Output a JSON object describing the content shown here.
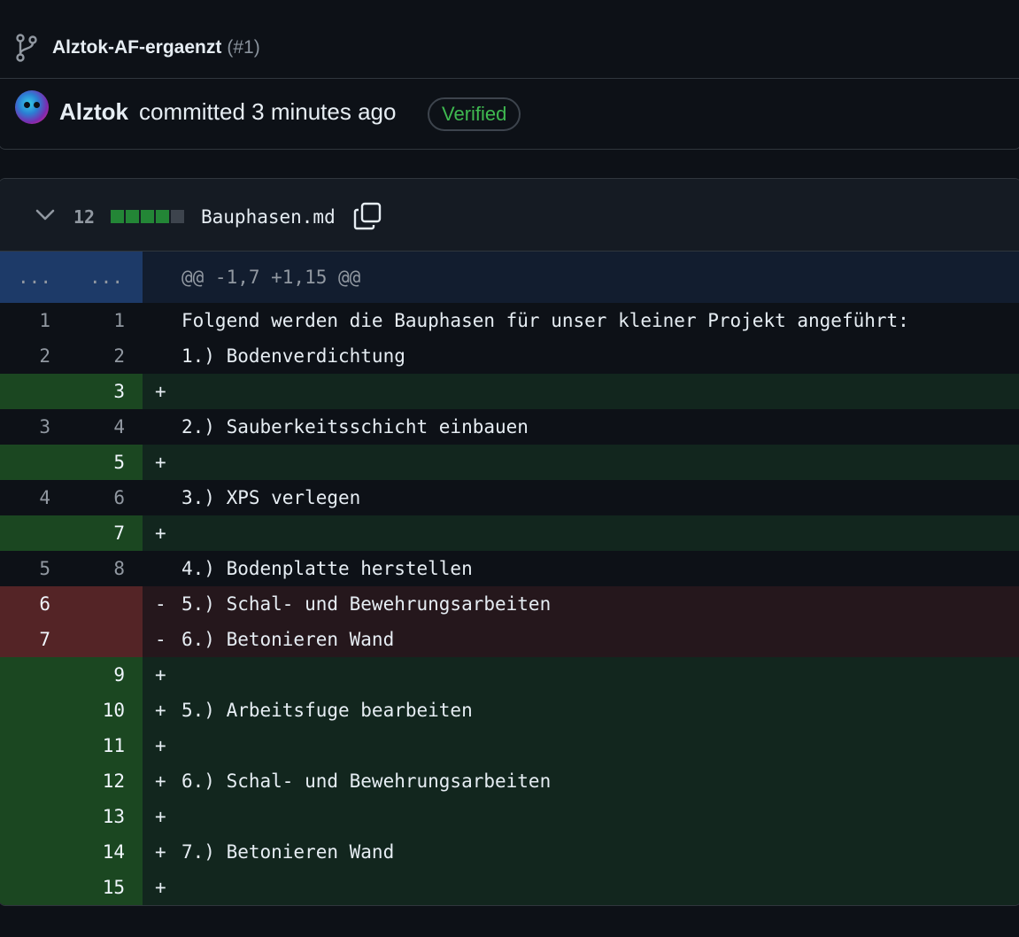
{
  "commit": {
    "branch_name": "Alztok-AF-ergaenzt",
    "pr_number": "(#1)",
    "author": "Alztok",
    "meta": "committed 3 minutes ago",
    "verified_label": "Verified"
  },
  "file": {
    "changes_count": "12",
    "diffstat": [
      "add",
      "add",
      "add",
      "add",
      "neutral"
    ],
    "name": "Bauphasen.md"
  },
  "diff": {
    "hunk": {
      "old": "...",
      "new": "...",
      "header": "@@ -1,7 +1,15 @@"
    },
    "lines": [
      {
        "type": "ctx",
        "old": "1",
        "new": "1",
        "sign": "",
        "text": "Folgend werden die Bauphasen für unser kleiner Projekt angeführt:"
      },
      {
        "type": "ctx",
        "old": "2",
        "new": "2",
        "sign": "",
        "text": "1.) Bodenverdichtung"
      },
      {
        "type": "add",
        "old": "",
        "new": "3",
        "sign": "+",
        "text": ""
      },
      {
        "type": "ctx",
        "old": "3",
        "new": "4",
        "sign": "",
        "text": "2.) Sauberkeitsschicht einbauen"
      },
      {
        "type": "add",
        "old": "",
        "new": "5",
        "sign": "+",
        "text": ""
      },
      {
        "type": "ctx",
        "old": "4",
        "new": "6",
        "sign": "",
        "text": "3.) XPS verlegen"
      },
      {
        "type": "add",
        "old": "",
        "new": "7",
        "sign": "+",
        "text": ""
      },
      {
        "type": "ctx",
        "old": "5",
        "new": "8",
        "sign": "",
        "text": "4.) Bodenplatte herstellen"
      },
      {
        "type": "del",
        "old": "6",
        "new": "",
        "sign": "-",
        "text": "5.) Schal- und Bewehrungsarbeiten"
      },
      {
        "type": "del",
        "old": "7",
        "new": "",
        "sign": "-",
        "text": "6.) Betonieren Wand"
      },
      {
        "type": "add",
        "old": "",
        "new": "9",
        "sign": "+",
        "text": ""
      },
      {
        "type": "add",
        "old": "",
        "new": "10",
        "sign": "+",
        "text": "5.) Arbeitsfuge bearbeiten"
      },
      {
        "type": "add",
        "old": "",
        "new": "11",
        "sign": "+",
        "text": ""
      },
      {
        "type": "add",
        "old": "",
        "new": "12",
        "sign": "+",
        "text": "6.) Schal- und Bewehrungsarbeiten"
      },
      {
        "type": "add",
        "old": "",
        "new": "13",
        "sign": "+",
        "text": ""
      },
      {
        "type": "add",
        "old": "",
        "new": "14",
        "sign": "+",
        "text": "7.) Betonieren Wand"
      },
      {
        "type": "add",
        "old": "",
        "new": "15",
        "sign": "+",
        "text": ""
      }
    ]
  },
  "colors": {
    "background": "#0d1117",
    "addition_gutter": "#1b4721",
    "addition_row": "#12261e",
    "deletion_gutter": "#542426",
    "deletion_row": "#25171c",
    "hunk_gutter": "#1d3a68",
    "verified_green": "#3fb950"
  },
  "icons": {
    "branch": "git-branch-icon",
    "chevron": "chevron-down-icon",
    "copy": "copy-icon"
  }
}
